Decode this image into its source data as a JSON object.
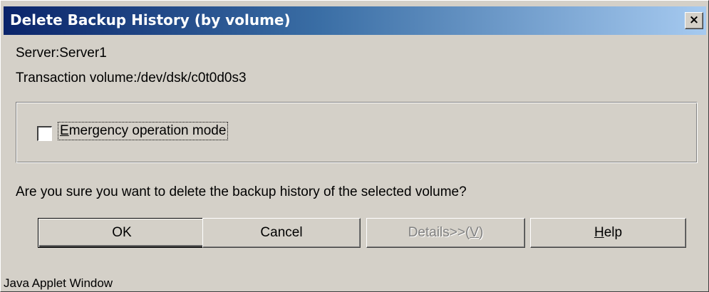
{
  "dialog": {
    "title": "Delete Backup History (by volume)",
    "close_glyph": "×",
    "close_icon": "close-icon"
  },
  "info": {
    "server_line": "Server:Server1",
    "volume_line": "Transaction volume:/dev/dsk/c0t0d0s3"
  },
  "option": {
    "checked": false,
    "label_mnemonic": "E",
    "label_rest": "mergency operation mode"
  },
  "message": "Are you sure you want to delete the backup history of the selected volume?",
  "buttons": {
    "ok": "OK",
    "cancel": "Cancel",
    "details_prefix": "Details>>(",
    "details_mnemonic": "V",
    "details_suffix": ")",
    "help_mnemonic": "H",
    "help_rest": "elp"
  },
  "footer": "Java Applet Window"
}
